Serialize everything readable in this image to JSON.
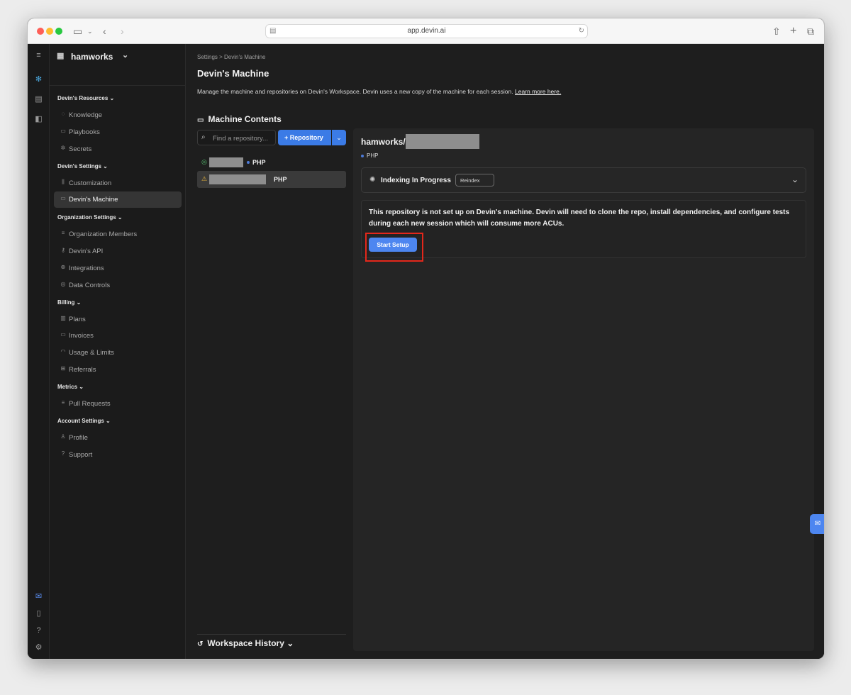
{
  "browser": {
    "url": "app.devin.ai"
  },
  "sidebar": {
    "org_name": "hamworks",
    "sections": [
      {
        "title": "Devin's Resources ⌄",
        "items": [
          "Knowledge",
          "Playbooks",
          "Secrets"
        ]
      },
      {
        "title": "Devin's Settings ⌄",
        "items": [
          "Customization",
          "Devin's Machine"
        ]
      },
      {
        "title": "Organization Settings ⌄",
        "items": [
          "Organization Members",
          "Devin's API",
          "Integrations",
          "Data Controls"
        ]
      },
      {
        "title": "Billing ⌄",
        "items": [
          "Plans",
          "Invoices",
          "Usage & Limits",
          "Referrals"
        ]
      },
      {
        "title": "Metrics ⌄",
        "items": [
          "Pull Requests"
        ]
      },
      {
        "title": "Account Settings ⌄",
        "items": [
          "Profile",
          "Support"
        ]
      }
    ],
    "active_item": "Devin's Machine"
  },
  "main": {
    "breadcrumb": "Settings  >  Devin's Machine",
    "title": "Devin's Machine",
    "description": "Manage the machine and repositories on Devin's Workspace. Devin uses a new copy of the machine for each session.",
    "learn_more": "Learn more here.",
    "machine_contents_title": "Machine Contents",
    "search_placeholder": "Find a repository...",
    "add_repo_label": "+ Repository",
    "repos": [
      {
        "status": "ok",
        "language": "PHP"
      },
      {
        "status": "warning",
        "language": "PHP",
        "selected": true
      }
    ],
    "workspace_history": "Workspace History"
  },
  "detail": {
    "repo_prefix": "hamworks/",
    "language": "PHP",
    "indexing_status": "Indexing In Progress",
    "reindex_label": "Reindex",
    "setup_message": "This repository is not set up on Devin's machine. Devin will need to clone the repo, install dependencies, and configure tests during each new session which will consume more ACUs.",
    "start_setup_label": "Start Setup"
  },
  "colors": {
    "accent": "#3b7be6",
    "highlight": "#e3271b",
    "background": "#1e1e1e"
  }
}
